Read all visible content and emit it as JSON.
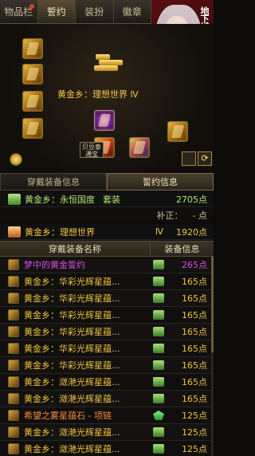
{
  "tabs": [
    {
      "label": "物品栏",
      "badge": true
    },
    {
      "label": "誓约",
      "active": true
    },
    {
      "label": "装扮"
    },
    {
      "label": "徽章"
    }
  ],
  "portrait": {
    "logo": "地下城"
  },
  "equip": {
    "title": "黄金乡：理想世界 Ⅳ",
    "pill_label": "贝豆泰\n通宝",
    "corner_right_glyph": "⟳"
  },
  "subtabs": [
    "穿戴装备信息",
    "誓约信息"
  ],
  "set_rows": [
    {
      "name": "黄金乡：永恒国度",
      "tag": "套装",
      "value": "2705点",
      "style": "green"
    },
    {
      "name": "黄金乡：理想世界",
      "level": "Ⅳ",
      "value": "1920点",
      "style": "gold"
    }
  ],
  "correction": {
    "label": "补正：",
    "value": "- 点"
  },
  "list_header": {
    "name": "穿戴装备名称",
    "info": "装备信息"
  },
  "items": [
    {
      "name": "梦中的黄金誓约",
      "value": "265点",
      "color": "purple",
      "icon": "std"
    },
    {
      "name": "黄金乡：华彩光辉星蕴...",
      "value": "165点",
      "color": "gold",
      "icon": "std"
    },
    {
      "name": "黄金乡：华彩光辉星蕴...",
      "value": "165点",
      "color": "gold",
      "icon": "std"
    },
    {
      "name": "黄金乡：华彩光辉星蕴...",
      "value": "165点",
      "color": "gold",
      "icon": "std"
    },
    {
      "name": "黄金乡：华彩光辉星蕴...",
      "value": "165点",
      "color": "gold",
      "icon": "std"
    },
    {
      "name": "黄金乡：华彩光辉星蕴...",
      "value": "165点",
      "color": "gold",
      "icon": "std"
    },
    {
      "name": "黄金乡：华彩光辉星蕴...",
      "value": "165点",
      "color": "gold",
      "icon": "std"
    },
    {
      "name": "黄金乡：潋滟光辉星蕴...",
      "value": "165点",
      "color": "gold",
      "icon": "std"
    },
    {
      "name": "黄金乡：潋滟光辉星蕴...",
      "value": "165点",
      "color": "gold",
      "icon": "std"
    },
    {
      "name": "希望之雾星蕴石 - 项链",
      "value": "125点",
      "color": "orange",
      "icon": "alt"
    },
    {
      "name": "黄金乡：潋滟光辉星蕴...",
      "value": "125点",
      "color": "gold",
      "icon": "std"
    },
    {
      "name": "黄金乡：潋滟光辉星蕴...",
      "value": "125点",
      "color": "gold",
      "icon": "std"
    }
  ]
}
